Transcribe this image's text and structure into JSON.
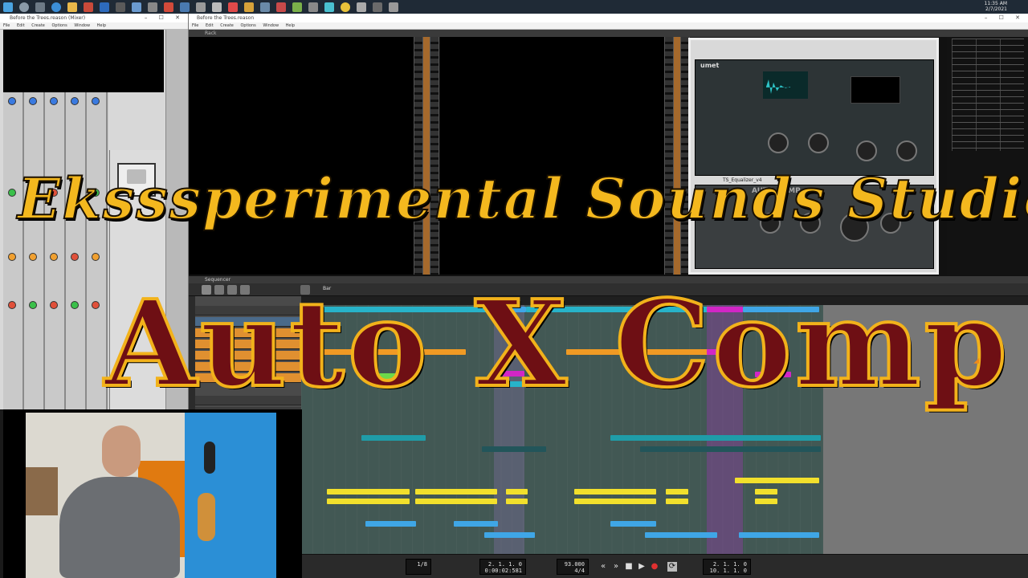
{
  "taskbar": {
    "clock_time": "11:35 AM",
    "clock_date": "2/7/2021"
  },
  "left_window": {
    "title": "Before the Trees.reason (Mixer)",
    "menu": [
      "File",
      "Edit",
      "Create",
      "Options",
      "Window",
      "Help"
    ]
  },
  "main_window": {
    "title": "Before the Trees.reason",
    "menu": [
      "File",
      "Edit",
      "Create",
      "Options",
      "Window",
      "Help"
    ],
    "rack_label": "Rack",
    "sequencer_label": "Sequencer",
    "seq_snap_label": "Bar"
  },
  "devices": {
    "umet_brand": "umet",
    "autocomp_label": "AUTO COMP",
    "eq_label": "TS_Equalizer_v4"
  },
  "transport": {
    "quantize": "1/8",
    "position": "2. 1. 1.   0",
    "time": "0:00:02:581",
    "tempo": "93.000",
    "signature": "4/4",
    "loop_left": "2. 1. 1.   0",
    "loop_right": "10. 1. 1.   0"
  },
  "overlay": {
    "studio_title": "Eksssperimental Sounds Studio",
    "episode_title": "Auto X Comp"
  },
  "colors": {
    "title_gold": "#f4b81e",
    "title_maroon": "#6e0f14",
    "clip_cyan": "#27b3c9",
    "clip_yellow": "#f2e02c",
    "clip_magenta": "#d226c6"
  }
}
